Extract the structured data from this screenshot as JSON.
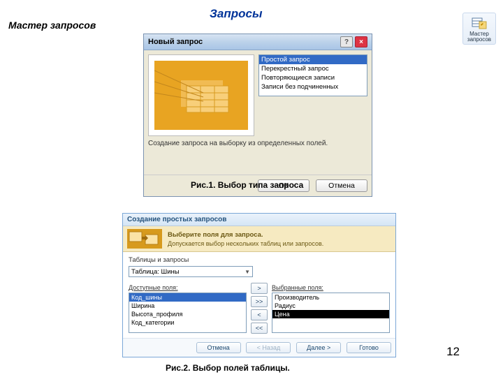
{
  "page": {
    "title": "Запросы",
    "sidebar_label": "Мастер запросов",
    "number": "12"
  },
  "toolbar": {
    "wizard_label": "Мастер\nзапросов"
  },
  "captions": {
    "fig1": "Рис.1. Выбор типа запроса",
    "fig2": "Рис.2. Выбор полей таблицы."
  },
  "dialog1": {
    "title": "Новый запрос",
    "options": [
      "Простой запрос",
      "Перекрестный запрос",
      "Повторяющиеся записи",
      "Записи без подчиненных"
    ],
    "selected_index": 0,
    "description": "Создание запроса на выборку из определенных полей.",
    "ok": "ОК",
    "cancel": "Отмена"
  },
  "dialog2": {
    "title": "Создание простых запросов",
    "banner_line1": "Выберите поля для запроса.",
    "banner_line2": "Допускается выбор нескольких таблиц или запросов.",
    "tables_label": "Таблицы и запросы",
    "table_selected": "Таблица: Шины",
    "available_label": "Доступные поля:",
    "selected_label": "Выбранные поля:",
    "available": [
      "Код_шины",
      "Ширина",
      "Высота_профиля",
      "Код_категории"
    ],
    "available_sel_index": 0,
    "selected": [
      "Производитель",
      "Радиус",
      "Цена"
    ],
    "selected_hl_index": 2,
    "move": {
      "one_right": ">",
      "all_right": ">>",
      "one_left": "<",
      "all_left": "<<"
    },
    "buttons": {
      "cancel": "Отмена",
      "back": "< Назад",
      "next": "Далее >",
      "finish": "Готово"
    }
  }
}
